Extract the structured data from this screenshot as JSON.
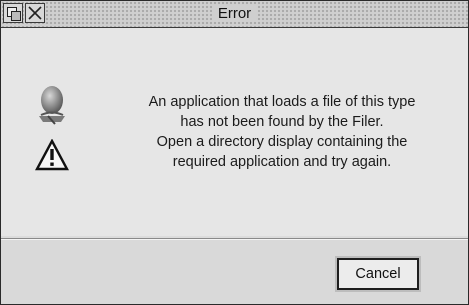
{
  "window": {
    "title": "Error",
    "title_buttons": [
      "back-icon",
      "close-icon"
    ]
  },
  "message": {
    "lines": [
      "An application that loads a file of this type",
      "has not been found by the Filer.",
      "Open a directory display containing the",
      "required application and try again."
    ],
    "icons": [
      "application-icon",
      "warning-icon"
    ]
  },
  "buttons": {
    "cancel_label": "Cancel"
  }
}
